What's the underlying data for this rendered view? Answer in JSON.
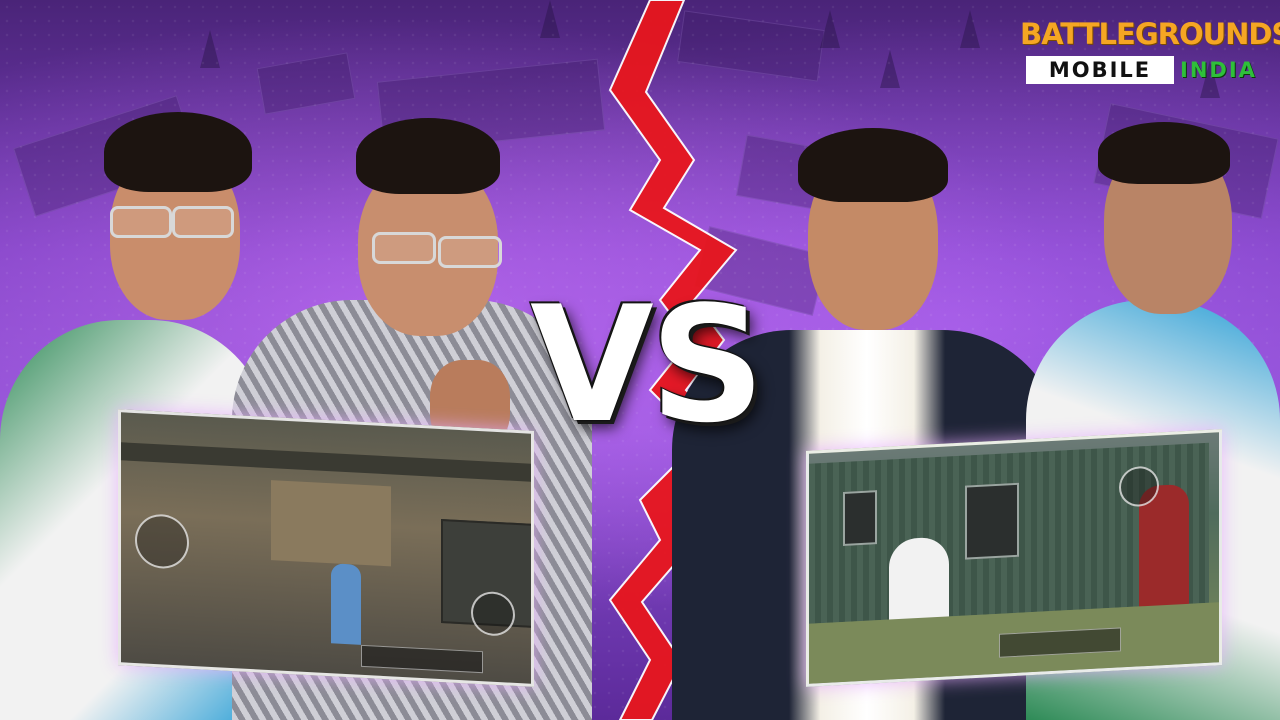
{
  "logo": {
    "top": "BATTLEGROUNDS",
    "mobile": "MOBILE",
    "india": "INDIA",
    "colors": {
      "top": "#f5a623",
      "mobile_bg": "#ffffff",
      "india": "#2fbf3a"
    }
  },
  "center_text": "VS",
  "accent": {
    "crack": "#e8161d",
    "background": "#8b4fd2",
    "glow": "#e6aaff"
  }
}
